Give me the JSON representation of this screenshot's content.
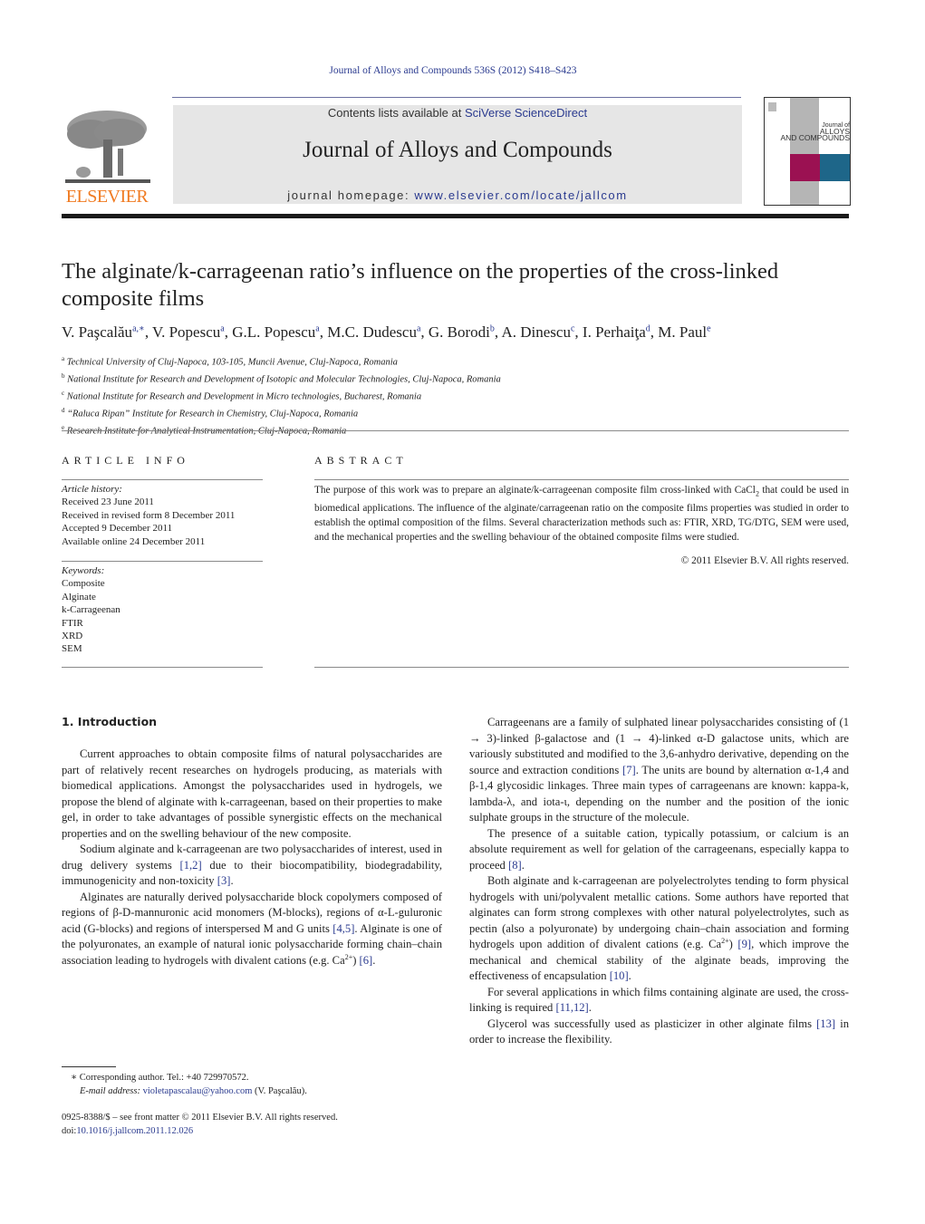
{
  "header": {
    "journal_reference": "Journal of Alloys and Compounds 536S (2012) S418–S423",
    "contents_prefix": "Contents lists available at ",
    "contents_link": "SciVerse ScienceDirect",
    "journal_title": "Journal of Alloys and Compounds",
    "homepage_prefix": "journal homepage: ",
    "homepage_link": "www.elsevier.com/locate/jallcom",
    "publisher_logo_text": "ELSEVIER",
    "cover": {
      "line1": "Journal of",
      "line2": "ALLOYS",
      "line3": "AND COMPOUNDS",
      "colors": {
        "magenta": "#9b1152",
        "teal": "#1e6689",
        "grey": "#b5b5b5"
      }
    }
  },
  "article": {
    "title": "The alginate/k-carrageenan ratio’s influence on the properties of the cross-linked composite films",
    "authors": [
      {
        "name": "V. Paşcalău",
        "sup": "a,∗"
      },
      {
        "name": "V. Popescu",
        "sup": "a"
      },
      {
        "name": "G.L. Popescu",
        "sup": "a"
      },
      {
        "name": "M.C. Dudescu",
        "sup": "a"
      },
      {
        "name": "G. Borodi",
        "sup": "b"
      },
      {
        "name": "A. Dinescu",
        "sup": "c"
      },
      {
        "name": "I. Perhaiţa",
        "sup": "d"
      },
      {
        "name": "M. Paul",
        "sup": "e"
      }
    ],
    "affiliations": [
      {
        "key": "a",
        "text": "Technical University of Cluj-Napoca, 103-105, Muncii Avenue, Cluj-Napoca, Romania"
      },
      {
        "key": "b",
        "text": "National Institute for Research and Development of Isotopic and Molecular Technologies, Cluj-Napoca, Romania"
      },
      {
        "key": "c",
        "text": "National Institute for Research and Development in Micro technologies, Bucharest, Romania"
      },
      {
        "key": "d",
        "text": "“Raluca Ripan” Institute for Research in Chemistry, Cluj-Napoca, Romania"
      },
      {
        "key": "e",
        "text": "Research Institute for Analytical Instrumentation, Cluj-Napoca, Romania"
      }
    ]
  },
  "article_info": {
    "heading": "ARTICLE INFO",
    "history_label": "Article history:",
    "history": [
      "Received 23 June 2011",
      "Received in revised form 8 December 2011",
      "Accepted 9 December 2011",
      "Available online 24 December 2011"
    ],
    "keywords_label": "Keywords:",
    "keywords": [
      "Composite",
      "Alginate",
      "k-Carrageenan",
      "FTIR",
      "XRD",
      "SEM"
    ]
  },
  "abstract": {
    "heading": "ABSTRACT",
    "text_before_sub": "The purpose of this work was to prepare an alginate/k-carrageenan composite film cross-linked with CaCl",
    "sub": "2",
    "text_after_sub": " that could be used in biomedical applications. The influence of the alginate/carrageenan ratio on the composite films properties was studied in order to establish the optimal composition of the films. Several characterization methods such as: FTIR, XRD, TG/DTG, SEM were used, and the mechanical properties and the swelling behaviour of the obtained composite films were studied.",
    "copyright": "© 2011 Elsevier B.V. All rights reserved."
  },
  "introduction": {
    "heading": "1.  Introduction",
    "left": {
      "p1": "Current approaches to obtain composite films of natural polysaccharides are part of relatively recent researches on hydrogels producing, as materials with biomedical applications. Amongst the polysaccharides used in hydrogels, we propose the blend of alginate with k-carrageenan, based on their properties to make gel, in order to take advantages of possible synergistic effects on the mechanical properties and on the swelling behaviour of the new composite.",
      "p2_a": "Sodium alginate and k-carrageenan are two polysaccharides of interest, used in drug delivery systems ",
      "p2_ref1": "[1,2]",
      "p2_b": " due to their biocompatibility, biodegradability, immunogenicity and non-toxicity ",
      "p2_ref2": "[3]",
      "p2_c": ".",
      "p3_a": "Alginates are naturally derived polysaccharide block copolymers composed of regions of β-",
      "p3_d": "D",
      "p3_b": "-mannuronic acid monomers (M-blocks), regions of α-",
      "p3_l": "L",
      "p3_c": "-guluronic acid (G-blocks) and regions of interspersed M and G units ",
      "p3_ref1": "[4,5]",
      "p3_e": ". Alginate is one of the polyuronates, an example of natural ionic polysaccharide forming chain–chain association leading to hydrogels with divalent cations (e.g. Ca",
      "p3_sup": "2+",
      "p3_f": ") ",
      "p3_ref2": "[6]",
      "p3_g": "."
    },
    "right": {
      "p1_a": "Carrageenans are a family of sulphated linear polysaccharides consisting of (1 → 3)-linked β-galactose and (1 → 4)-linked α-",
      "p1_d": "D",
      "p1_b": " galactose units, which are variously substituted and modified to the 3,6-anhydro derivative, depending on the source and extraction conditions ",
      "p1_ref": "[7]",
      "p1_c": ". The units are bound by alternation α-1,4 and β-1,4 glycosidic linkages. Three main types of carrageenans are known: kappa-k, lambda-λ, and iota-ι, depending on the number and the position of the ionic sulphate groups in the structure of the molecule.",
      "p2_a": "The presence of a suitable cation, typically potassium, or calcium is an absolute requirement as well for gelation of the carrageenans, especially kappa to proceed ",
      "p2_ref": "[8]",
      "p2_b": ".",
      "p3_a": "Both alginate and k-carrageenan are polyelectrolytes tending to form physical hydrogels with uni/polyvalent metallic cations. Some authors have reported that alginates can form strong complexes with other natural polyelectrolytes, such as pectin (also a polyuronate) by undergoing chain–chain association and forming hydrogels upon addition of divalent cations (e.g. Ca",
      "p3_sup": "2+",
      "p3_b": ") ",
      "p3_ref1": "[9]",
      "p3_c": ", which improve the mechanical and chemical stability of the alginate beads, improving the effectiveness of encapsulation ",
      "p3_ref2": "[10]",
      "p3_d": ".",
      "p4_a": "For several applications in which films containing alginate are used, the cross-linking is required ",
      "p4_ref": "[11,12]",
      "p4_b": ".",
      "p5_a": "Glycerol was successfully used as plasticizer in other alginate films ",
      "p5_ref": "[13]",
      "p5_b": " in order to increase the flexibility."
    }
  },
  "footnotes": {
    "corresponding": "∗  Corresponding author. Tel.: +40 729970572.",
    "email_label": "E-mail address:",
    "email": "violetapascalau@yahoo.com",
    "email_suffix": " (V. Paşcalău).",
    "issn_line": "0925-8388/$ – see front matter © 2011 Elsevier B.V. All rights reserved.",
    "doi_prefix": "doi:",
    "doi": "10.1016/j.jallcom.2011.12.026"
  }
}
